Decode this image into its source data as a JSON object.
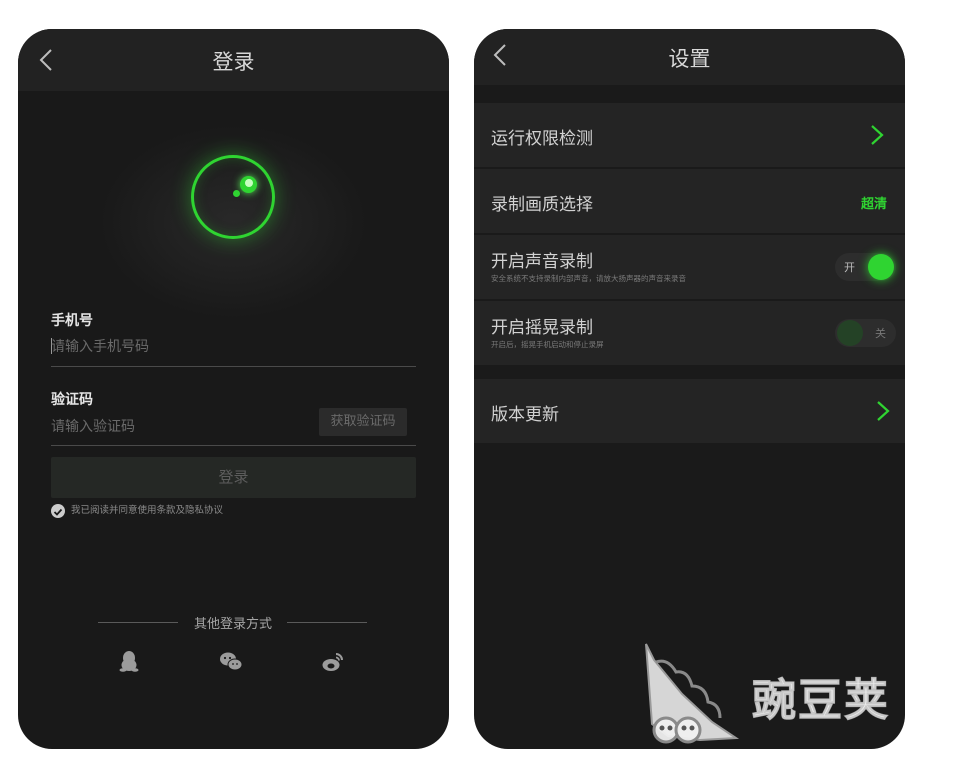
{
  "login": {
    "title": "登录",
    "phone_label": "手机号",
    "phone_placeholder": "请输入手机号码",
    "code_label": "验证码",
    "code_placeholder": "请输入验证码",
    "get_code_button": "获取验证码",
    "login_button": "登录",
    "agreement": "我已阅读并同意使用条款及隐私协议",
    "other_login_label": "其他登录方式",
    "social_icons": [
      "qq-icon",
      "wechat-icon",
      "weibo-icon"
    ]
  },
  "settings": {
    "title": "设置",
    "rows": [
      {
        "label": "运行权限检测",
        "icon": "chevron-right-icon"
      },
      {
        "label": "录制画质选择",
        "value": "超清"
      },
      {
        "label": "开启声音录制",
        "desc": "安全系统不支持录制内部声音，请放大扬声器的声音来录音",
        "toggle_text": "开",
        "on": true
      },
      {
        "label": "开启摇晃录制",
        "desc": "开启后，摇晃手机启动和停止录屏",
        "toggle_text": "关",
        "on": false
      },
      {
        "label": "版本更新",
        "icon": "chevron-right-icon"
      }
    ]
  },
  "colors": {
    "accent": "#2fd431",
    "background": "#1a1a1a",
    "row": "#242424"
  },
  "watermark": "豌豆荚"
}
